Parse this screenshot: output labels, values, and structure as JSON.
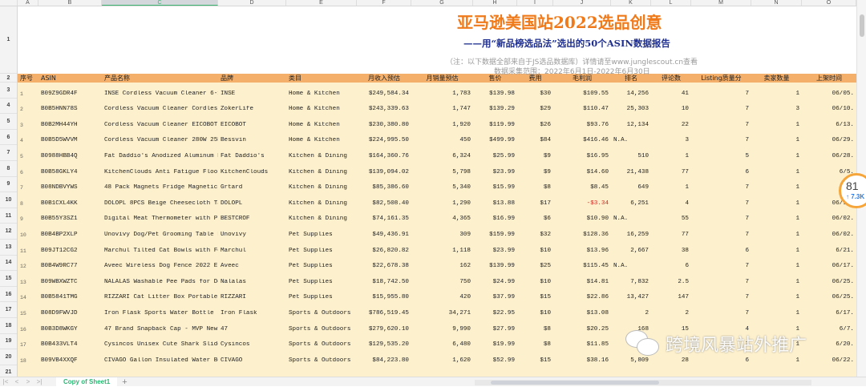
{
  "columns": [
    "A",
    "B",
    "C",
    "D",
    "E",
    "F",
    "G",
    "H",
    "I",
    "J",
    "K",
    "L",
    "M",
    "N",
    "O"
  ],
  "selected_column": "C",
  "title": "亚马逊美国站2022选品创意",
  "subtitle": "——用“新品榜选品法”选出的50个ASIN数据报告",
  "note": "（注：以下数据全部来自于JS选品数据库）详情请至www.junglescout.cn查看",
  "date_range": "数据采集范围：2022年6月1日-2022年6月30日",
  "headers": [
    "序号",
    "ASIN",
    "产品名称",
    "品牌",
    "类目",
    "月收入预估",
    "月销量预估",
    "售价",
    "费用",
    "毛利润",
    "排名",
    "评论数",
    "Listing质量分",
    "卖家数量",
    "上架时间"
  ],
  "rows": [
    [
      "1",
      "B09Z9GDR4F",
      "INSE Cordless Vacuum Cleaner 6-1",
      "INSE",
      "Home & Kitchen",
      "$249,584.34",
      "1,783",
      "$139.98",
      "$30",
      "$109.55",
      "14,256",
      "41",
      "7",
      "1",
      "06/05."
    ],
    [
      "2",
      "B0B5HNN78S",
      "Cordless Vacuum Cleaner Cordless",
      "ZokerLife",
      "Home & Kitchen",
      "$243,339.63",
      "1,747",
      "$139.29",
      "$29",
      "$110.47",
      "25,303",
      "10",
      "7",
      "3",
      "06/10."
    ],
    [
      "3",
      "B0B2MH44YH",
      "Cordless Vacuum Cleaner EICOBOT",
      "EICOBOT",
      "Home & Kitchen",
      "$230,380.80",
      "1,920",
      "$119.99",
      "$26",
      "$93.76",
      "12,134",
      "22",
      "7",
      "1",
      "6/13."
    ],
    [
      "4",
      "B0B5D5WVVM",
      "Cordless Vacuum Cleaner 280W 25K",
      "Bessvin",
      "Home & Kitchen",
      "$224,995.50",
      "450",
      "$499.99",
      "$84",
      "$416.46",
      "N.A.",
      "3",
      "7",
      "1",
      "06/29."
    ],
    [
      "5",
      "B0988HBB4Q",
      "Fat Daddio's Anodized Aluminum R",
      "Fat Daddio's",
      "Kitchen & Dining",
      "$164,360.76",
      "6,324",
      "$25.99",
      "$9",
      "$16.95",
      "510",
      "1",
      "5",
      "1",
      "06/28."
    ],
    [
      "6",
      "B0B58GKLY4",
      "KitchenClouds Anti Fatigue Floor",
      "KitchenClouds",
      "Kitchen & Dining",
      "$139,094.02",
      "5,798",
      "$23.99",
      "$9",
      "$14.60",
      "21,438",
      "77",
      "6",
      "1",
      "6/5."
    ],
    [
      "7",
      "B08NDBVYWS",
      "48 Pack Magnets Fridge Magnetic",
      "Grtard",
      "Kitchen & Dining",
      "$85,386.60",
      "5,340",
      "$15.99",
      "$8",
      "$8.45",
      "649",
      "1",
      "7",
      "1",
      "06/"
    ],
    [
      "8",
      "B0B1CXL4KK",
      "DOLOPL 8PCS Beige Cheesecloth Ta",
      "DOLOPL",
      "Kitchen & Dining",
      "$82,508.40",
      "1,290",
      "$13.88",
      "$17",
      "-$3.34",
      "6,251",
      "4",
      "7",
      "1",
      "06/10."
    ],
    [
      "9",
      "B0B55Y3SZ1",
      "Digital Meat Thermometer with Pr",
      "BESTCROF",
      "Kitchen & Dining",
      "$74,161.35",
      "4,365",
      "$16.99",
      "$6",
      "$10.90",
      "N.A.",
      "55",
      "7",
      "1",
      "06/02."
    ],
    [
      "10",
      "B0B4BP2XLP",
      "Unovivy Dog/Pet Grooming Table F",
      "Unovivy",
      "Pet Supplies",
      "$49,436.91",
      "309",
      "$159.99",
      "$32",
      "$128.36",
      "16,259",
      "77",
      "7",
      "1",
      "06/02."
    ],
    [
      "11",
      "B09JT12CG2",
      "Marchul Tilted Cat Bowls with Fe",
      "Marchul",
      "Pet Supplies",
      "$26,820.82",
      "1,118",
      "$23.99",
      "$10",
      "$13.96",
      "2,667",
      "38",
      "6",
      "1",
      "6/21."
    ],
    [
      "12",
      "B0B4W9RC77",
      "Aveec Wireless Dog Fence 2022 El",
      "Aveec",
      "Pet Supplies",
      "$22,678.38",
      "162",
      "$139.99",
      "$25",
      "$115.45",
      "N.A.",
      "6",
      "7",
      "1",
      "06/17."
    ],
    [
      "13",
      "B09WBXWZTC",
      "NALALAS Washable Pee Pads for Do",
      "Nalalas",
      "Pet Supplies",
      "$18,742.50",
      "750",
      "$24.99",
      "$10",
      "$14.81",
      "7,832",
      "2.5",
      "7",
      "1",
      "06/25."
    ],
    [
      "14",
      "B0B5841TMG",
      "RIZZARI Cat Litter Box Portable",
      "RIZZARI",
      "Pet Supplies",
      "$15,955.80",
      "420",
      "$37.99",
      "$15",
      "$22.86",
      "13,427",
      "147",
      "7",
      "1",
      "06/25."
    ],
    [
      "15",
      "B08D9FWVJD",
      "Iron Flask Sports Water Bottle -",
      "Iron Flask",
      "Sports & Outdoors",
      "$786,519.45",
      "34,271",
      "$22.95",
      "$10",
      "$13.08",
      "2",
      "2",
      "7",
      "1",
      "6/17."
    ],
    [
      "16",
      "B0B3D8WKGY",
      "47 Brand Snapback Cap - MVP New",
      "47",
      "Sports & Outdoors",
      "$279,620.10",
      "9,990",
      "$27.99",
      "$8",
      "$20.25",
      "168",
      "15",
      "4",
      "1",
      "6/7."
    ],
    [
      "17",
      "B0B433VLT4",
      "Cysincos Unisex Cute Shark Slide",
      "Cysincos",
      "Sports & Outdoors",
      "$129,535.20",
      "6,480",
      "$19.99",
      "$8",
      "$11.85",
      "",
      "",
      "7",
      "1",
      "6/20."
    ],
    [
      "18",
      "B09VB4XXQF",
      "CIVAGO Gallon Insulated Water Bo",
      "CIVAGO",
      "Sports & Outdoors",
      "$84,223.80",
      "1,620",
      "$52.99",
      "$15",
      "$38.16",
      "5,809",
      "28",
      "6",
      "1",
      "06/22."
    ]
  ],
  "sheet_tab": "Copy of Sheet1",
  "add_sheet": "+",
  "badge": {
    "value": "81",
    "sub": "↑ 7.3K"
  },
  "watermark": "跨境风暴站外推广",
  "colors": {
    "header_bg": "#f4b06b",
    "row_bg": "#fdf0cc",
    "title": "#f07a1a",
    "subtitle": "#1f2f8f",
    "negative": "#e02020"
  }
}
